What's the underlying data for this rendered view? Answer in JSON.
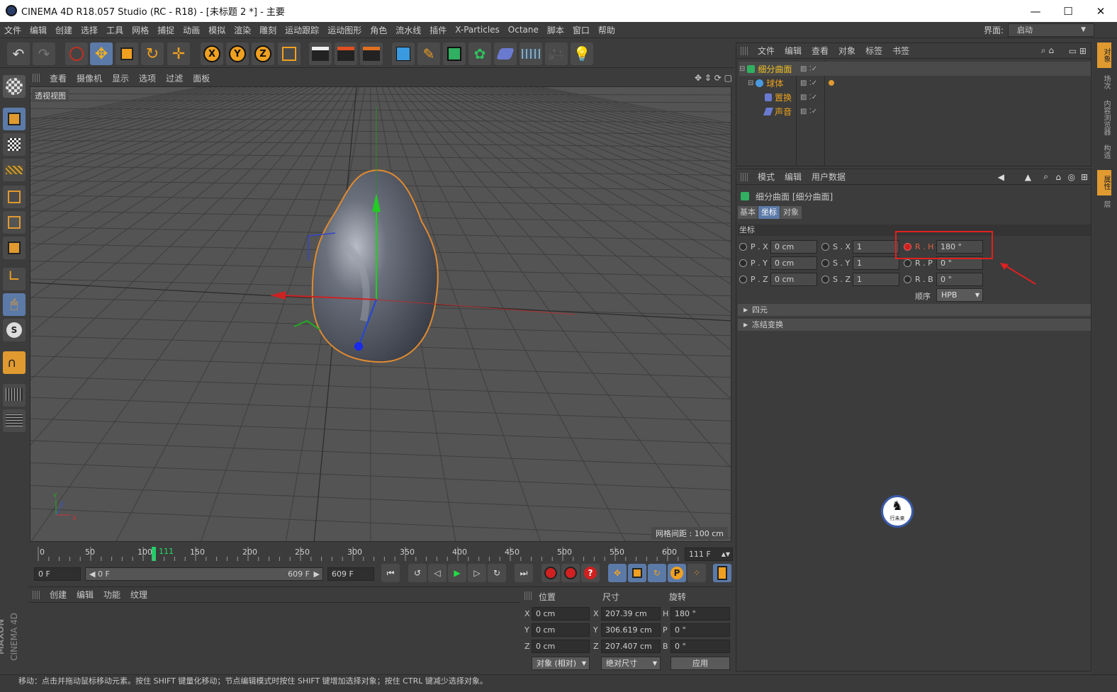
{
  "window": {
    "title": "CINEMA 4D R18.057 Studio (RC - R18) - [未标题 2 *] - 主要"
  },
  "menu": [
    "文件",
    "编辑",
    "创建",
    "选择",
    "工具",
    "网格",
    "捕捉",
    "动画",
    "模拟",
    "渲染",
    "雕刻",
    "运动跟踪",
    "运动图形",
    "角色",
    "流水线",
    "插件",
    "X-Particles",
    "Octane",
    "脚本",
    "窗口",
    "帮助"
  ],
  "layout": {
    "label": "界面:",
    "value": "启动"
  },
  "viewport": {
    "menu": [
      "查看",
      "摄像机",
      "显示",
      "选项",
      "过滤",
      "面板"
    ],
    "label": "透视视图",
    "grid_spacing": "网格间距 : 100 cm",
    "axis_labels": {
      "x": "X",
      "y": "Y",
      "z": "Z"
    }
  },
  "timeline": {
    "ticks": [
      "0",
      "50",
      "100",
      "150",
      "200",
      "250",
      "300",
      "350",
      "400",
      "450",
      "500",
      "550",
      "600"
    ],
    "current": "111",
    "frame_field": "111 F"
  },
  "transport": {
    "start": "0 F",
    "range_start": "0 F",
    "range_end": "609 F",
    "end": "609 F"
  },
  "material": {
    "menu": [
      "创建",
      "编辑",
      "功能",
      "纹理"
    ]
  },
  "coords": {
    "headers": [
      "位置",
      "尺寸",
      "旋转"
    ],
    "rows": [
      {
        "axis": "X",
        "pos": "0 cm",
        "size_axis": "X",
        "size": "207.39 cm",
        "rot_axis": "H",
        "rot": "180 °"
      },
      {
        "axis": "Y",
        "pos": "0 cm",
        "size_axis": "Y",
        "size": "306.619 cm",
        "rot_axis": "P",
        "rot": "0 °"
      },
      {
        "axis": "Z",
        "pos": "0 cm",
        "size_axis": "Z",
        "size": "207.407 cm",
        "rot_axis": "B",
        "rot": "0 °"
      }
    ],
    "mode": "对象 (相对)",
    "size_mode": "绝对尺寸",
    "apply": "应用"
  },
  "objects": {
    "menu": [
      "文件",
      "编辑",
      "查看",
      "对象",
      "标签",
      "书签"
    ],
    "items": [
      {
        "name": "细分曲面",
        "color": "#f0c020"
      },
      {
        "name": "球体",
        "color": "#e8a020"
      },
      {
        "name": "置换",
        "color": "#e8a020"
      },
      {
        "name": "声音",
        "color": "#e8a020"
      }
    ]
  },
  "attributes": {
    "menu": [
      "模式",
      "编辑",
      "用户数据"
    ],
    "object_title": "细分曲面 [细分曲面]",
    "tabs": [
      "基本",
      "坐标",
      "对象"
    ],
    "section": "坐标",
    "fields": {
      "px": {
        "label": "P . X",
        "value": "0 cm"
      },
      "py": {
        "label": "P . Y",
        "value": "0 cm"
      },
      "pz": {
        "label": "P . Z",
        "value": "0 cm"
      },
      "sx": {
        "label": "S . X",
        "value": "1"
      },
      "sy": {
        "label": "S . Y",
        "value": "1"
      },
      "sz": {
        "label": "S . Z",
        "value": "1"
      },
      "rh": {
        "label": "R . H",
        "value": "180 °"
      },
      "rp": {
        "label": "R . P",
        "value": "0 °"
      },
      "rb": {
        "label": "R . B",
        "value": "0 °"
      }
    },
    "order_label": "顺序",
    "order_value": "HPB",
    "groups": [
      "四元",
      "冻结变换"
    ]
  },
  "right_tabs": [
    "对象",
    "场次",
    "内容浏览器",
    "构造",
    "属性",
    "层"
  ],
  "status": "移动：点击并拖动鼠标移动元素。按住 SHIFT 键量化移动；节点编辑模式时按住 SHIFT 键增加选择对象；按住 CTRL 键减少选择对象。",
  "brand": {
    "line1": "MAXON",
    "line2": "CINEMA 4D"
  },
  "watermark_text": "行未来",
  "colors": {
    "accent": "#5c7aa8",
    "highlight_box": "#e02020",
    "object_name": "#e8a020"
  }
}
